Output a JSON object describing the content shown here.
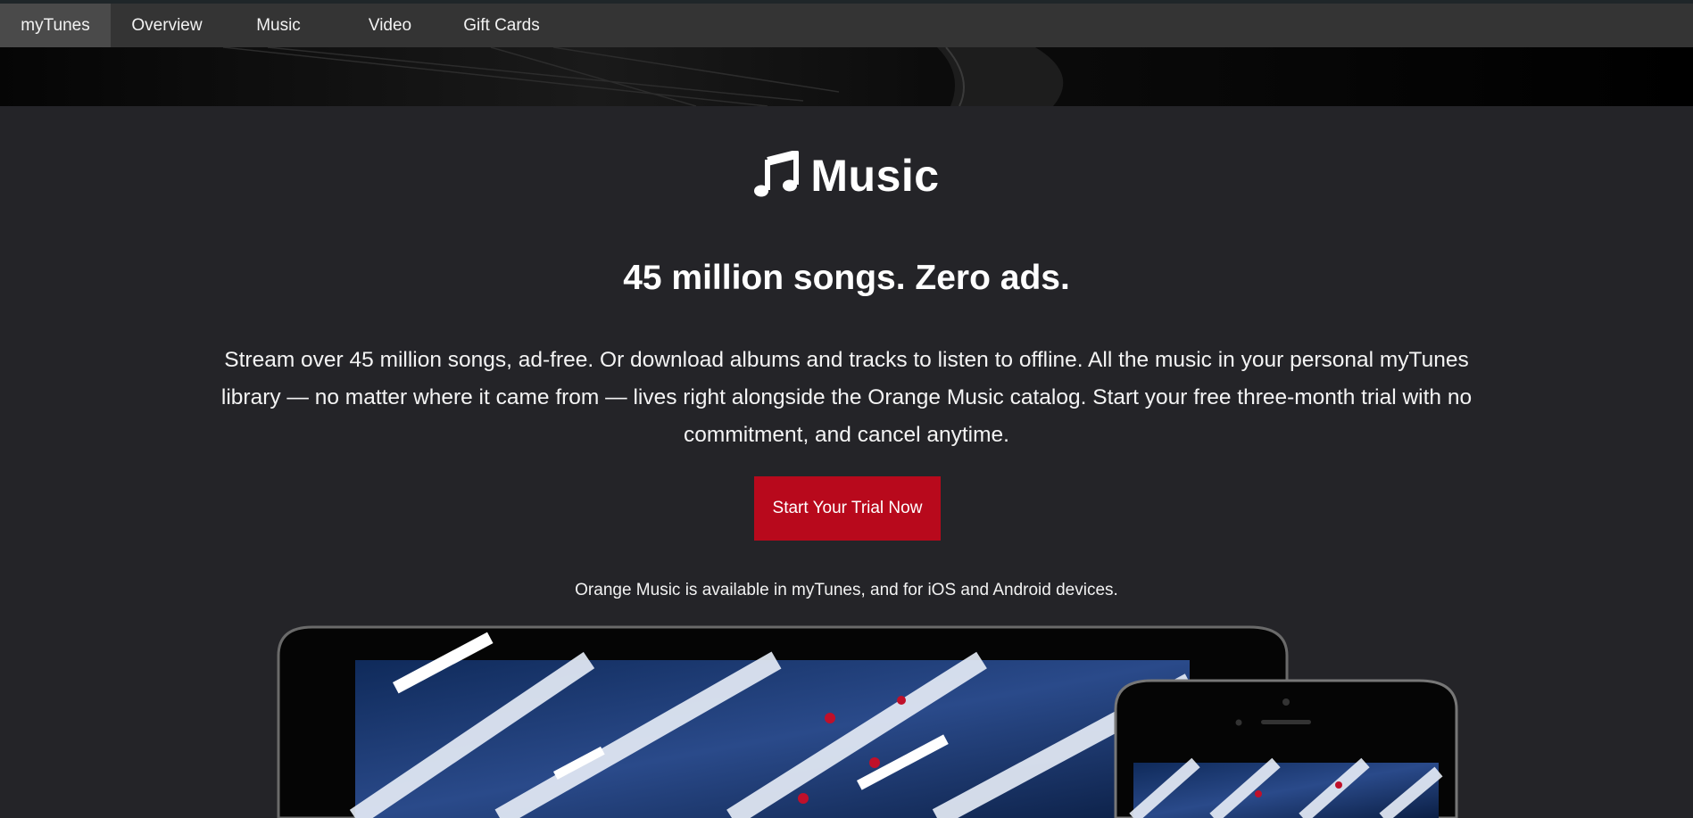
{
  "nav": {
    "items": [
      {
        "label": "myTunes",
        "active": true
      },
      {
        "label": "Overview",
        "active": false
      },
      {
        "label": "Music",
        "active": false
      },
      {
        "label": "Video",
        "active": false
      },
      {
        "label": "Gift Cards",
        "active": false
      }
    ]
  },
  "logo": {
    "icon": "music-note-icon",
    "text": "Music"
  },
  "headline": "45 million songs. Zero ads.",
  "description": "Stream over 45 million songs, ad-free. Or download albums and tracks to listen to offline. All the music in your personal myTunes library — no matter where it came from — lives right alongside the Orange Music catalog. Start your free three-month trial with no commitment, and cancel anytime.",
  "cta": {
    "label": "Start Your Trial Now"
  },
  "availability": "Orange Music is available in myTunes, and for iOS and Android devices.",
  "colors": {
    "background": "#242428",
    "navbar": "#343434",
    "nav_active": "#4a4a4a",
    "cta": "#b8091c"
  }
}
